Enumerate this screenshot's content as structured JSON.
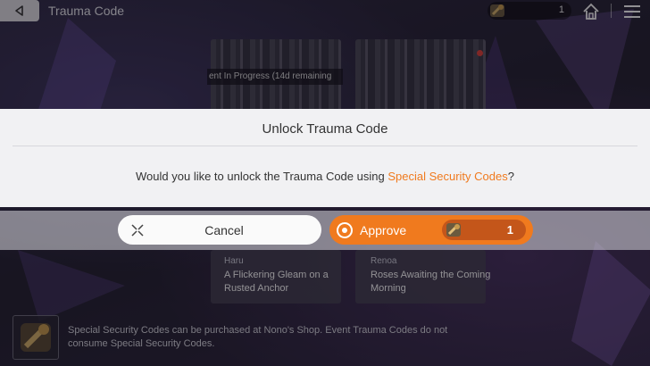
{
  "topbar": {
    "title": "Trauma Code",
    "currency_count": "1",
    "icons": [
      "back-arrow-icon",
      "security-code-icon",
      "home-icon",
      "menu-icon"
    ]
  },
  "background": {
    "event_status": "ent In Progress (14d remaining",
    "cards": [
      {
        "author": "Haru",
        "title": "A Flickering Gleam on a Rusted Anchor"
      },
      {
        "author": "Renoa",
        "title": "Roses Awaiting the Coming Morning"
      }
    ],
    "info_text": "Special Security Codes can be purchased at Nono's Shop. Event Trauma Codes do not consume Special Security Codes."
  },
  "dialog": {
    "title": "Unlock Trauma Code",
    "message_before": "Would you like to unlock the Trauma Code using ",
    "message_highlight": "Special Security Codes",
    "message_after": "?",
    "cancel_label": "Cancel",
    "approve_label": "Approve",
    "approve_cost": "1"
  },
  "colors": {
    "accent": "#f07a1e",
    "accent_dark": "#c4561a",
    "dialog_bg": "#f1f1f3",
    "text_dark": "#333333"
  }
}
